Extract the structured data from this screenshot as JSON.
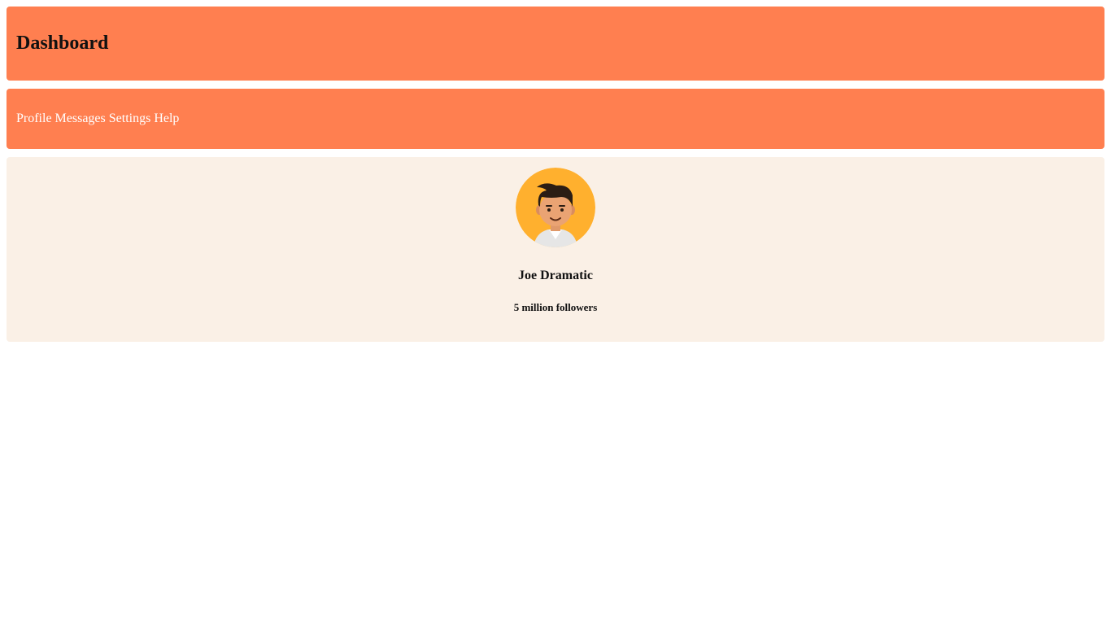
{
  "header": {
    "title": "Dashboard"
  },
  "nav": {
    "items": [
      {
        "label": "Profile"
      },
      {
        "label": "Messages"
      },
      {
        "label": "Settings"
      },
      {
        "label": "Help"
      }
    ]
  },
  "profile": {
    "avatar_icon": "user-avatar-icon",
    "name": "Joe Dramatic",
    "followers": "5 million followers"
  },
  "colors": {
    "accent": "#ff7f50",
    "card_background": "#faf0e6",
    "avatar_background": "#ffb02e"
  }
}
